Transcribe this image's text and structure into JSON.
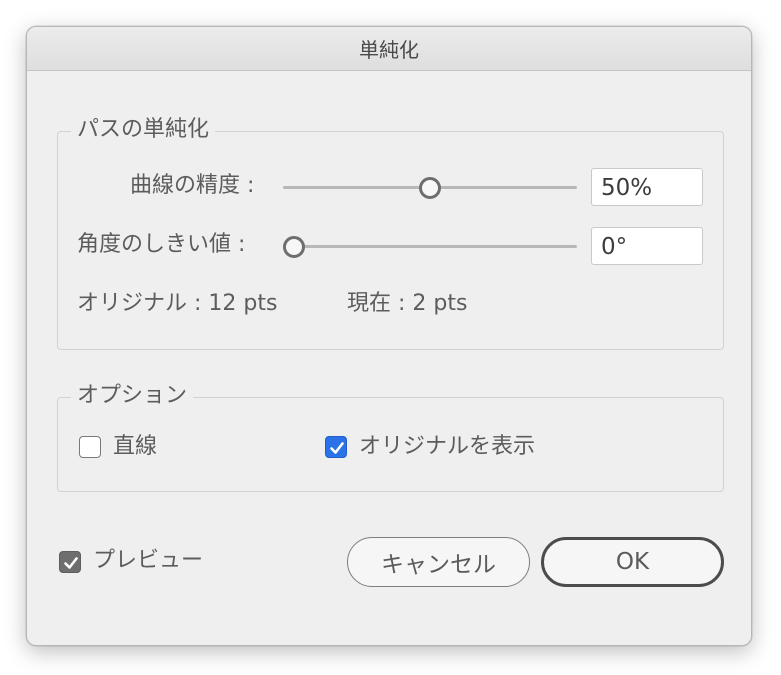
{
  "dialog": {
    "title": "単純化"
  },
  "path_group": {
    "title": "パスの単純化",
    "curve_precision": {
      "label": "曲線の精度 :",
      "slider_fraction": 0.5,
      "value": "50%"
    },
    "angle_threshold": {
      "label": "角度のしきい値 :",
      "slider_fraction": 0.0,
      "value": "0°"
    },
    "stats": {
      "original": "オリジナル : 12 pts",
      "current": "現在 : 2 pts"
    }
  },
  "options_group": {
    "title": "オプション",
    "straight_lines": {
      "label": "直線",
      "checked": false
    },
    "show_original": {
      "label": "オリジナルを表示",
      "checked": true
    }
  },
  "footer": {
    "preview": {
      "label": "プレビュー",
      "checked": true
    },
    "cancel_label": "キャンセル",
    "ok_label": "OK"
  },
  "colors": {
    "dialog_bg": "#efefef",
    "checkbox_blue": "#2b72e8",
    "checkbox_gray": "#6e6e6e"
  }
}
